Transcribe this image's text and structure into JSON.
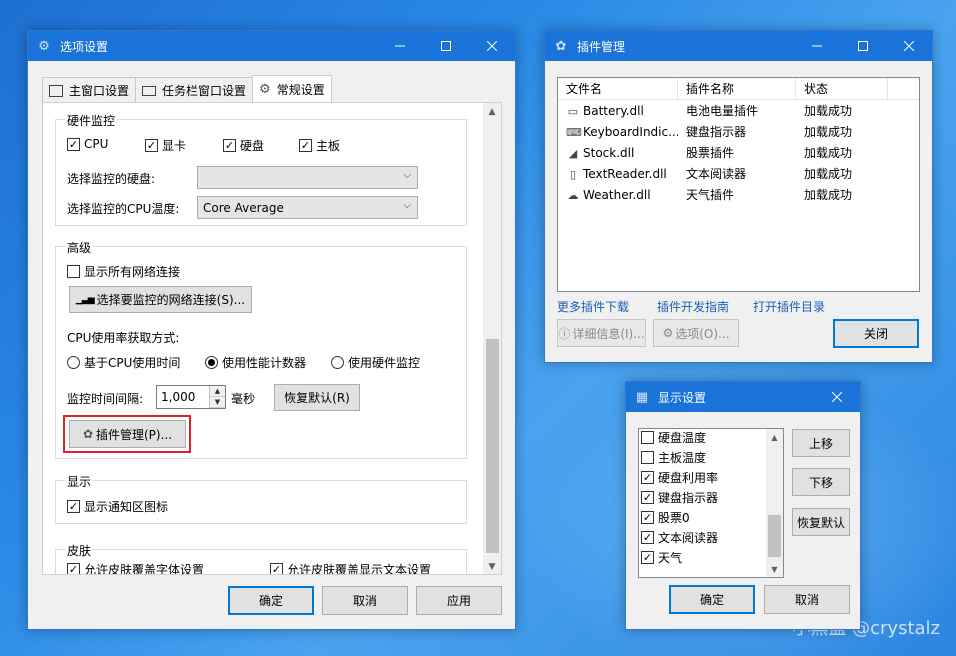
{
  "watermark": "小黑盒 @crystalz",
  "options_window": {
    "title": "选项设置",
    "tabs": [
      "主窗口设置",
      "任务栏窗口设置",
      "常规设置"
    ],
    "hardware": {
      "title": "硬件监控",
      "checks": [
        {
          "label": "CPU",
          "checked": "✓"
        },
        {
          "label": "显卡",
          "checked": "✓"
        },
        {
          "label": "硬盘",
          "checked": "✓"
        },
        {
          "label": "主板",
          "checked": "✓"
        }
      ],
      "disk_label": "选择监控的硬盘:",
      "disk_value": "",
      "cpu_temp_label": "选择监控的CPU温度:",
      "cpu_temp_value": "Core Average"
    },
    "advanced": {
      "title": "高级",
      "show_all_net": "显示所有网络连接",
      "select_net_button": "选择要监控的网络连接(S)...",
      "cpu_method_label": "CPU使用率获取方式:",
      "radios": [
        {
          "label": "基于CPU使用时间",
          "on": false
        },
        {
          "label": "使用性能计数器",
          "on": true
        },
        {
          "label": "使用硬件监控",
          "on": false
        }
      ],
      "interval_label": "监控时间间隔:",
      "interval_value": "1,000",
      "interval_unit": "毫秒",
      "restore_default": "恢复默认(R)",
      "plugin_manage": "插件管理(P)..."
    },
    "display": {
      "title": "显示",
      "show_tray_icon": "显示通知区图标"
    },
    "skin": {
      "title": "皮肤",
      "font_override": "允许皮肤覆盖字体设置",
      "text_override": "允许皮肤覆盖显示文本设置"
    },
    "buttons": {
      "ok": "确定",
      "cancel": "取消",
      "apply": "应用"
    }
  },
  "plugins_window": {
    "title": "插件管理",
    "columns": [
      "文件名",
      "插件名称",
      "状态"
    ],
    "rows": [
      {
        "icon": "battery-icon",
        "file": "Battery.dll",
        "name": "电池电量插件",
        "status": "加载成功"
      },
      {
        "icon": "keyboard-icon",
        "file": "KeyboardIndic...",
        "name": "键盘指示器",
        "status": "加载成功"
      },
      {
        "icon": "chart-icon",
        "file": "Stock.dll",
        "name": "股票插件",
        "status": "加载成功"
      },
      {
        "icon": "document-icon",
        "file": "TextReader.dll",
        "name": "文本阅读器",
        "status": "加载成功"
      },
      {
        "icon": "cloud-icon",
        "file": "Weather.dll",
        "name": "天气插件",
        "status": "加载成功"
      }
    ],
    "links": [
      "更多插件下载",
      "插件开发指南",
      "打开插件目录"
    ],
    "details_button": "详细信息(I)...",
    "options_button": "选项(O)...",
    "close_button": "关闭"
  },
  "display_window": {
    "title": "显示设置",
    "items": [
      {
        "label": "硬盘温度",
        "checked": ""
      },
      {
        "label": "主板温度",
        "checked": ""
      },
      {
        "label": "硬盘利用率",
        "checked": "✓"
      },
      {
        "label": "键盘指示器",
        "checked": "✓"
      },
      {
        "label": "股票0",
        "checked": "✓"
      },
      {
        "label": "文本阅读器",
        "checked": "✓"
      },
      {
        "label": "天气",
        "checked": "✓"
      }
    ],
    "up_button": "上移",
    "down_button": "下移",
    "restore_button": "恢复默认",
    "ok_button": "确定",
    "cancel_button": "取消"
  }
}
